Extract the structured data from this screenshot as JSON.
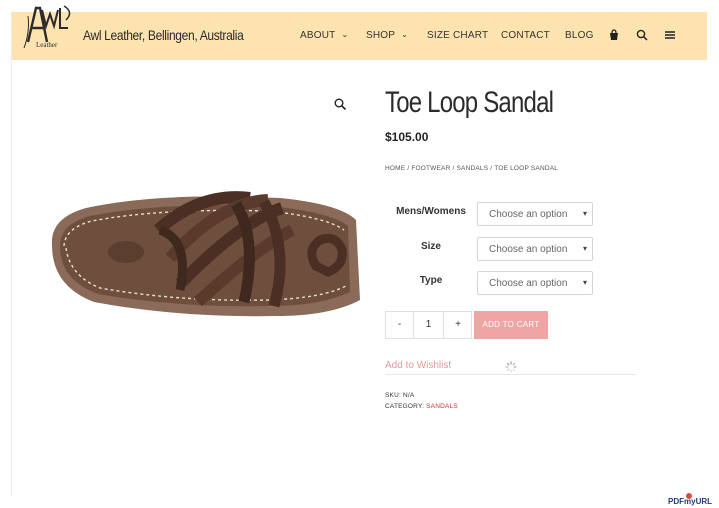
{
  "site": {
    "title": "Awl Leather, Bellingen, Australia",
    "logo_text": "Leather"
  },
  "nav": {
    "items": [
      {
        "label": "ABOUT",
        "dropdown": true
      },
      {
        "label": "SHOP",
        "dropdown": true
      },
      {
        "label": "SIZE CHART",
        "dropdown": false
      },
      {
        "label": "CONTACT",
        "dropdown": false
      },
      {
        "label": "BLOG",
        "dropdown": false
      }
    ],
    "icons": [
      "cart-icon",
      "search-icon",
      "menu-icon"
    ]
  },
  "product": {
    "title": "Toe Loop Sandal",
    "price": "$105.00",
    "breadcrumb": [
      "HOME",
      "FOOTWEAR",
      "SANDALS",
      "TOE LOOP SANDAL"
    ],
    "variations": [
      {
        "label": "Mens/Womens",
        "placeholder": "Choose an option"
      },
      {
        "label": "Size",
        "placeholder": "Choose an option"
      },
      {
        "label": "Type",
        "placeholder": "Choose an option"
      }
    ],
    "quantity": {
      "minus": "-",
      "value": "1",
      "plus": "+"
    },
    "add_to_cart": "ADD TO CART",
    "wishlist": "Add to Wishlist",
    "sku_label": "SKU:",
    "sku_value": "N/A",
    "category_label": "CATEGORY:",
    "category_value": "SANDALS"
  },
  "colors": {
    "header_bg": "#fce3b0",
    "button_bg": "#f0a5a5",
    "wishlist": "#e29a9a",
    "link": "#c0392b"
  },
  "watermark": "PDFmyURL"
}
